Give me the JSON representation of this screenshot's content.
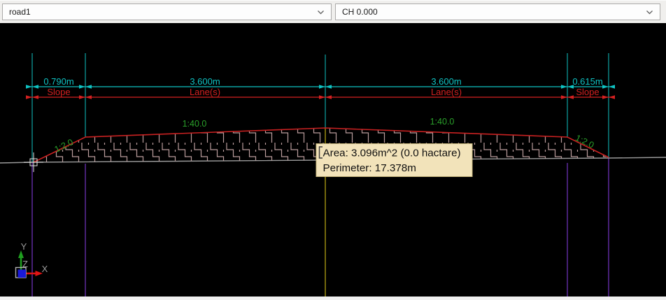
{
  "toolbar": {
    "road_dropdown": {
      "value": "road1"
    },
    "chainage_dropdown": {
      "value": "CH 0.000"
    }
  },
  "dimensions": {
    "segments": [
      {
        "value": "0.790m",
        "label": "Slope"
      },
      {
        "value": "3.600m",
        "label": "Lane(s)"
      },
      {
        "value": "3.600m",
        "label": "Lane(s)"
      },
      {
        "value": "0.615m",
        "label": "Slope"
      }
    ]
  },
  "slopes": {
    "left_batter": "1:2.0",
    "left_lane": "1:40.0",
    "right_lane": "1:40.0",
    "right_batter": "1:2.0"
  },
  "tooltip": {
    "area": "Area: 3.096m^2 (0.0 hactare)",
    "perimeter": "Perimeter: 17.378m"
  },
  "axis_gizmo": {
    "x": "X",
    "y": "Y",
    "z": "Z"
  },
  "colors": {
    "dimension_cyan": "#0fc3c3",
    "dimension_red": "#d42020",
    "slope_green": "#2aa02a",
    "guide_purple": "#6b31b5",
    "centerline_yellow": "#c0ae14",
    "ground_gray": "#9a9a9a",
    "hatch_pink": "#bb9d9d",
    "road_red": "#c92121",
    "tooltip_bg": "#f2e3ba"
  }
}
